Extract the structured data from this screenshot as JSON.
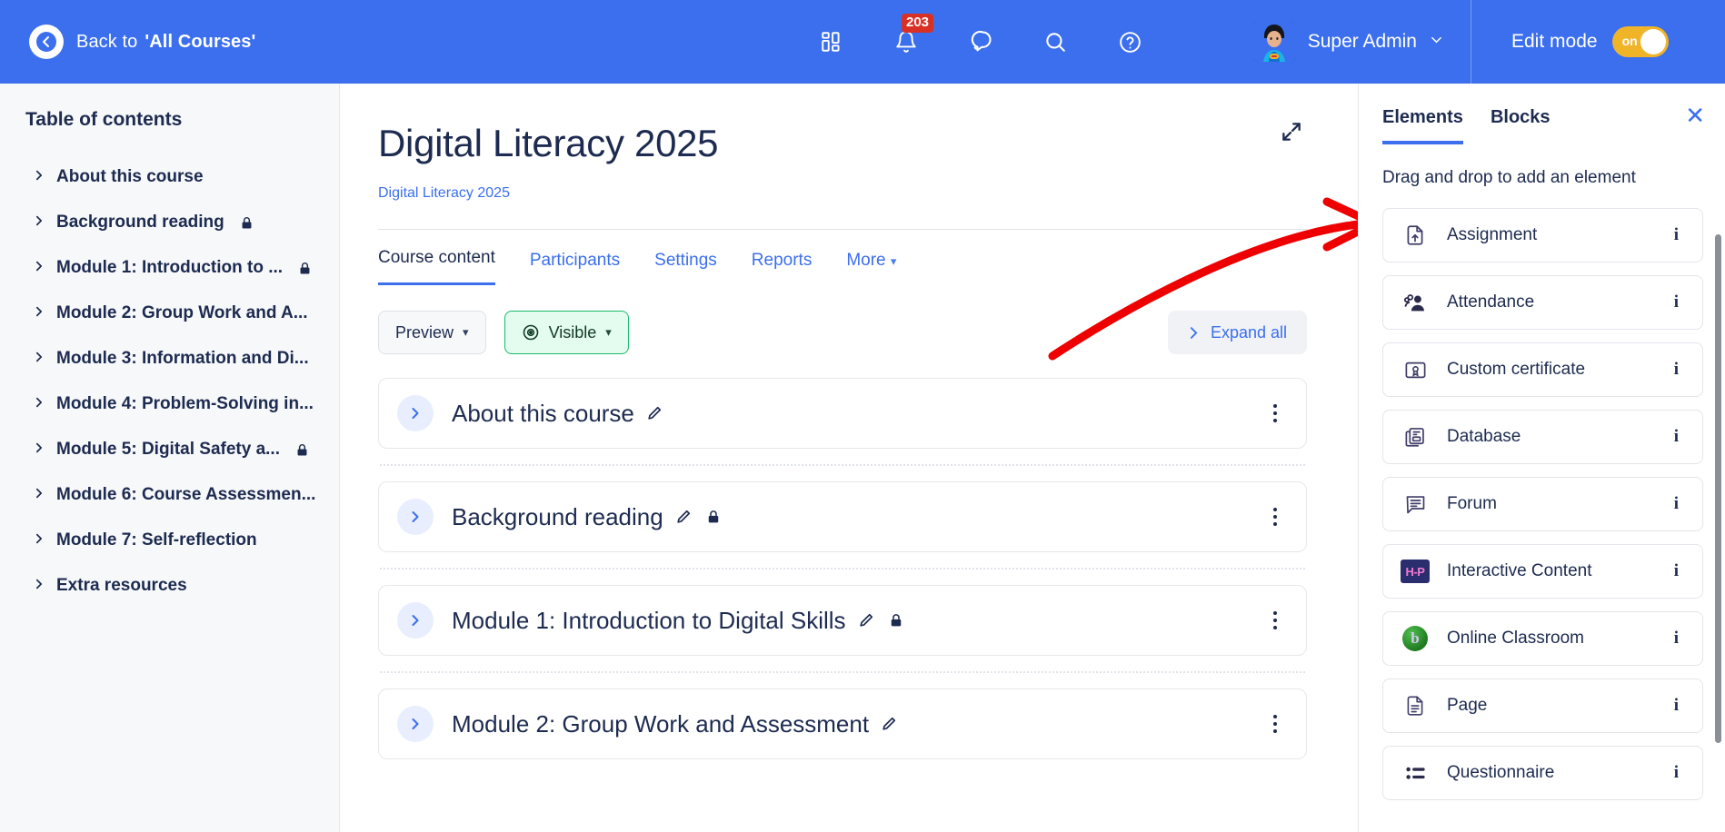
{
  "topnav": {
    "back_label": "Back to",
    "back_target": "'All Courses'",
    "back_icon": "arrow-left-circle-icon",
    "icons": [
      {
        "name": "apps-grid-icon",
        "label": "Apps"
      },
      {
        "name": "notifications-bell-icon",
        "label": "Notifications",
        "badge": "203"
      },
      {
        "name": "messages-icon",
        "label": "Messages"
      },
      {
        "name": "search-icon",
        "label": "Search"
      },
      {
        "name": "help-icon",
        "label": "Help"
      }
    ],
    "user_name": "Super Admin",
    "edit_mode_label": "Edit mode",
    "edit_mode_state": "on",
    "accent": "#3B6FEE",
    "toggle_color": "#F0B429",
    "badge_color": "#D93025"
  },
  "sidebar": {
    "title": "Table of contents",
    "items": [
      {
        "label": "About this course",
        "locked": false
      },
      {
        "label": "Background reading",
        "locked": true
      },
      {
        "label": "Module 1: Introduction to ...",
        "locked": true
      },
      {
        "label": "Module 2: Group Work and A...",
        "locked": false
      },
      {
        "label": "Module 3: Information and Di...",
        "locked": false
      },
      {
        "label": "Module 4: Problem-Solving in...",
        "locked": false
      },
      {
        "label": "Module 5: Digital Safety a...",
        "locked": true
      },
      {
        "label": "Module 6: Course Assessmen...",
        "locked": false
      },
      {
        "label": "Module 7: Self-reflection",
        "locked": false
      },
      {
        "label": "Extra resources",
        "locked": false
      }
    ]
  },
  "main": {
    "page_title": "Digital Literacy 2025",
    "breadcrumb": "Digital Literacy 2025",
    "expand_icon": "expand-fullscreen-icon",
    "tabs": [
      {
        "label": "Course content",
        "active": true
      },
      {
        "label": "Participants",
        "active": false
      },
      {
        "label": "Settings",
        "active": false
      },
      {
        "label": "Reports",
        "active": false
      },
      {
        "label": "More",
        "active": false,
        "caret": true
      }
    ],
    "toolbar": {
      "preview_label": "Preview",
      "visible_label": "Visible",
      "visible_icon": "eye-visible-icon",
      "expand_all_label": "Expand all"
    },
    "sections": [
      {
        "title": "About this course",
        "locked": false
      },
      {
        "title": "Background reading",
        "locked": true
      },
      {
        "title": "Module 1: Introduction to Digital Skills",
        "locked": true
      },
      {
        "title": "Module 2: Group Work and Assessment",
        "locked": false
      }
    ]
  },
  "rightpanel": {
    "tabs": [
      {
        "label": "Elements",
        "active": true
      },
      {
        "label": "Blocks",
        "active": false
      }
    ],
    "close_icon": "close-icon",
    "hint": "Drag and drop to add an element",
    "items": [
      {
        "label": "Assignment",
        "icon": "assignment-upload-icon",
        "info": "i"
      },
      {
        "label": "Attendance",
        "icon": "attendance-people-icon",
        "info": "i"
      },
      {
        "label": "Custom certificate",
        "icon": "certificate-icon",
        "info": "i"
      },
      {
        "label": "Database",
        "icon": "database-stack-icon",
        "info": "i"
      },
      {
        "label": "Forum",
        "icon": "forum-chat-icon",
        "info": "i"
      },
      {
        "label": "Interactive Content",
        "icon": "h5p-icon",
        "info": "i",
        "badge_text": "H-P"
      },
      {
        "label": "Online Classroom",
        "icon": "bigbluebutton-icon",
        "info": "i",
        "badge_text": "b"
      },
      {
        "label": "Page",
        "icon": "page-document-icon",
        "info": "i"
      },
      {
        "label": "Questionnaire",
        "icon": "questionnaire-icon",
        "info": "i"
      }
    ]
  },
  "annotation": {
    "type": "red-curved-arrow",
    "color": "#EE0000",
    "points_to": "expand-fullscreen-icon"
  }
}
